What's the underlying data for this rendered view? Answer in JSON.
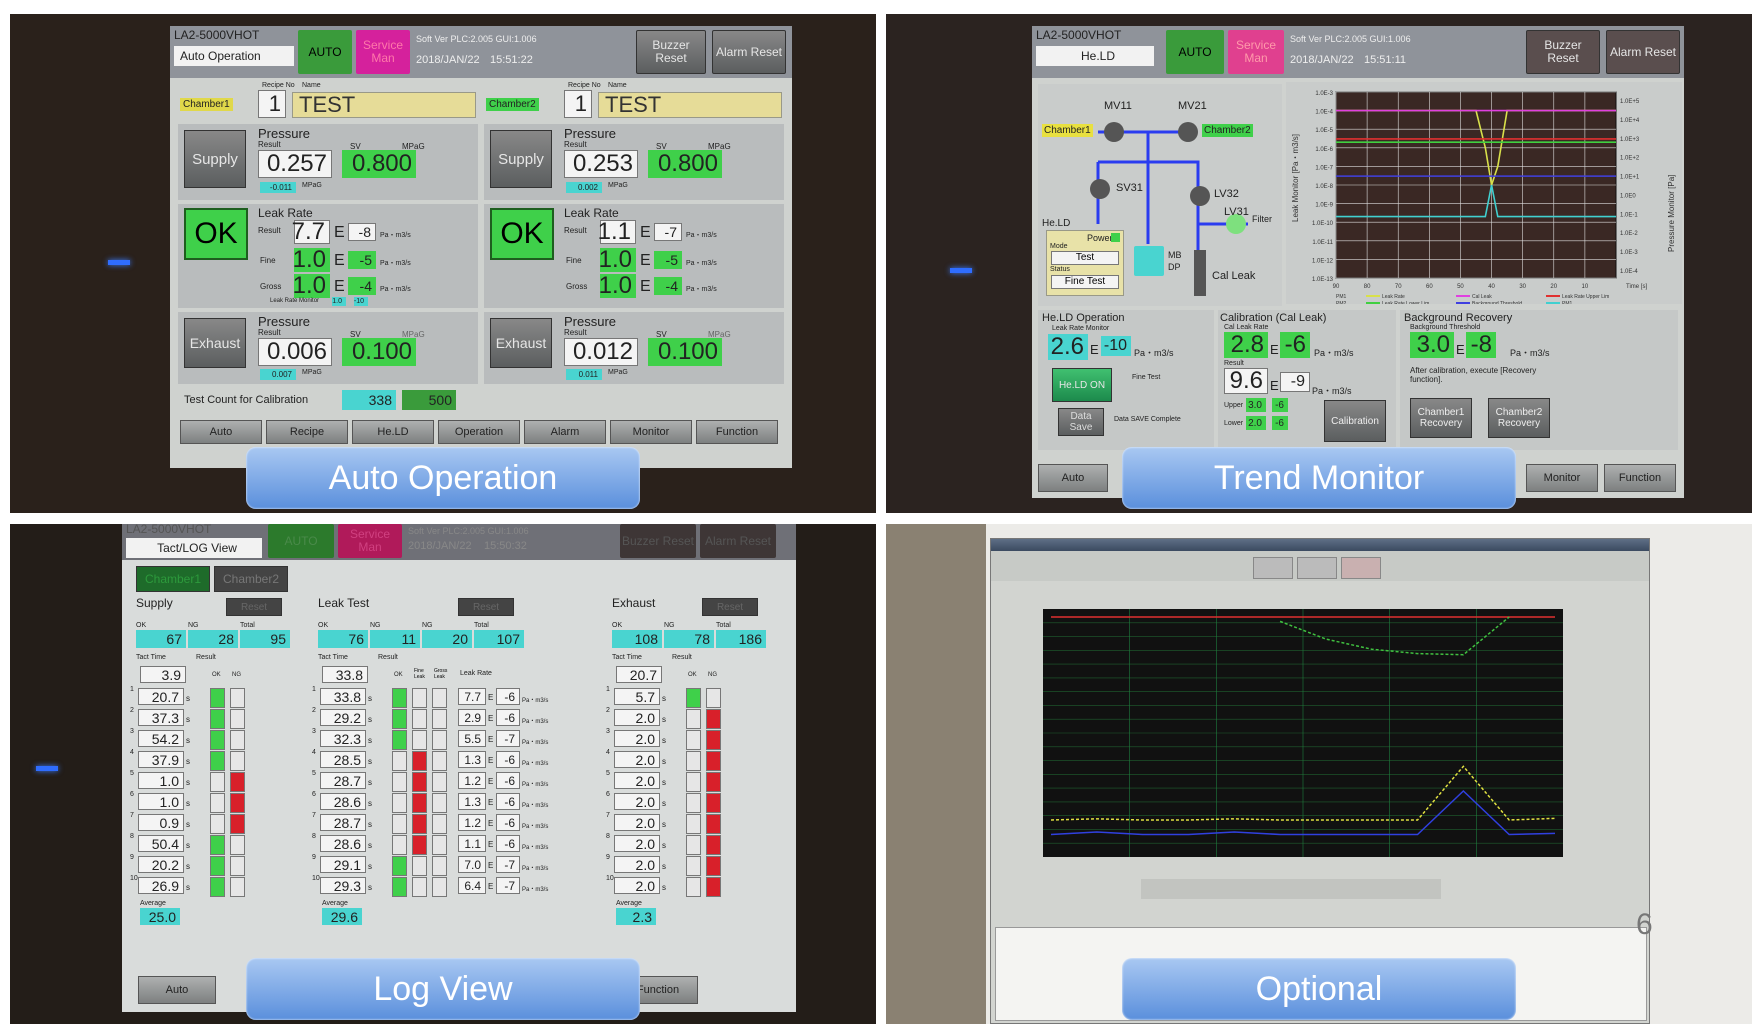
{
  "colors": {
    "ok_green": "#3fd04a",
    "auto_green": "#3a9b3b",
    "service_magenta": "#d5219c",
    "cyan": "#49d4d0",
    "ng_red": "#d8202a",
    "label_blue": "#6f9fe2"
  },
  "common": {
    "model": "LA2-5000VHOT",
    "auto": "AUTO",
    "service": "Service Man",
    "buzzer": "Buzzer Reset",
    "alarm": "Alarm Reset",
    "soft_ver": "Soft Ver PLC:2.005  GUI:1.006",
    "date": "2018/JAN/22"
  },
  "auto_op": {
    "caption": "Auto Operation",
    "screen_title": "Auto Operation",
    "time": "15:51:22",
    "recipe_no_label": "Recipe No",
    "name_label": "Name",
    "chambers": [
      {
        "label": "Chamber1",
        "recipe_no": "1",
        "name": "TEST",
        "supply_label": "Supply",
        "pressure_label": "Pressure",
        "result_label": "Result",
        "sv_label": "SV",
        "unit": "MPaG",
        "supply_result": "0.257",
        "supply_sv": "0.800",
        "supply_offset": "-0.011",
        "ok": "OK",
        "leak_label": "Leak Rate",
        "leak_result": "7.7",
        "leak_exp": "-8",
        "fine_label": "Fine",
        "fine_val": "1.0",
        "fine_exp": "-5",
        "gross_label": "Gross",
        "gross_val": "1.0",
        "gross_exp": "-4",
        "leak_unit": "Pa・m3/s",
        "monitor_label": "Leak Rate Monitor",
        "monitor_val": "1.0",
        "monitor_exp": "-10",
        "exhaust_label": "Exhaust",
        "exhaust_result": "0.006",
        "exhaust_sv": "0.100",
        "exhaust_offset": "0.007"
      },
      {
        "label": "Chamber2",
        "recipe_no": "1",
        "name": "TEST",
        "supply_label": "Supply",
        "pressure_label": "Pressure",
        "result_label": "Result",
        "sv_label": "SV",
        "unit": "MPaG",
        "supply_result": "0.253",
        "supply_sv": "0.800",
        "supply_offset": "0.002",
        "ok": "OK",
        "leak_label": "Leak Rate",
        "leak_result": "1.1",
        "leak_exp": "-7",
        "fine_label": "Fine",
        "fine_val": "1.0",
        "fine_exp": "-5",
        "gross_label": "Gross",
        "gross_val": "1.0",
        "gross_exp": "-4",
        "leak_unit": "Pa・m3/s",
        "exhaust_label": "Exhaust",
        "exhaust_result": "0.012",
        "exhaust_sv": "0.100",
        "exhaust_offset": "0.011"
      }
    ],
    "test_count_label": "Test Count for Calibration",
    "test_count": "338",
    "test_count_max": "500",
    "nav": [
      "Auto",
      "Recipe",
      "He.LD",
      "Operation",
      "Alarm",
      "Monitor",
      "Function"
    ]
  },
  "trend": {
    "caption": "Trend Monitor",
    "screen_title": "He.LD",
    "time": "15:51:11",
    "valves": [
      "MV11",
      "MV21",
      "SV31",
      "LV32",
      "LV31"
    ],
    "chamber1": "Chamber1",
    "chamber2": "Chamber2",
    "filter": "Filter",
    "held": "He.LD",
    "power": "Power",
    "mode_label": "Mode",
    "mode": "Test",
    "status_label": "Status",
    "status": "Fine Test",
    "mb": "MB",
    "dp": "DP",
    "cal_leak": "Cal Leak",
    "chart": {
      "type": "line",
      "ylabel_left": "Leak Monitor [Pa・m3/s]",
      "ylabel_right": "Pressure Monitor [Pa]",
      "xlabel": "Time [s]",
      "y_ticks_left": [
        "1.0E-3",
        "1.0E-4",
        "1.0E-5",
        "1.0E-6",
        "1.0E-7",
        "1.0E-8",
        "1.0E-9",
        "1.0E-10",
        "1.0E-11",
        "1.0E-12",
        "1.0E-13"
      ],
      "y_ticks_right": [
        "1.0E+5",
        "1.0E+4",
        "1.0E+3",
        "1.0E+2",
        "1.0E+1",
        "1.0E0",
        "1.0E-1",
        "1.0E-2",
        "1.0E-3",
        "1.0E-4"
      ],
      "x_ticks": [
        "90",
        "80",
        "70",
        "60",
        "50",
        "40",
        "30",
        "20",
        "10"
      ],
      "x": [
        90,
        80,
        70,
        60,
        50,
        45,
        42,
        40,
        38,
        35,
        30,
        20,
        10,
        0
      ],
      "series": [
        {
          "name": "Leak Rate",
          "color": "#d8e04a",
          "values": [
            0.0001,
            0.0001,
            0.0001,
            0.0001,
            0.0001,
            0.0001,
            1e-06,
            1e-08,
            1e-07,
            0.0001,
            0.0001,
            0.0001,
            0.0001,
            0.0001
          ]
        },
        {
          "name": "Cal Leak",
          "color": "#e040e0",
          "values": [
            0.0001,
            0.0001,
            0.0001,
            0.0001,
            0.0001,
            0.0001,
            0.0001,
            0.0001,
            0.0001,
            0.0001,
            0.0001,
            0.0001,
            0.0001,
            0.0001
          ]
        },
        {
          "name": "Leak Rate Upper Lim",
          "color": "#e03030",
          "values": [
            3e-06,
            3e-06,
            3e-06,
            3e-06,
            3e-06,
            3e-06,
            3e-06,
            3e-06,
            3e-06,
            3e-06,
            3e-06,
            3e-06,
            3e-06,
            3e-06
          ]
        },
        {
          "name": "Leak Rate Lower Lim",
          "color": "#40d040",
          "values": [
            2e-06,
            2e-06,
            2e-06,
            2e-06,
            2e-06,
            2e-06,
            2e-06,
            2e-06,
            2e-06,
            2e-06,
            2e-06,
            2e-06,
            2e-06,
            2e-06
          ]
        },
        {
          "name": "Background Threshold",
          "color": "#4040e0",
          "values": [
            3e-08,
            3e-08,
            3e-08,
            3e-08,
            3e-08,
            3e-08,
            3e-08,
            3e-08,
            3e-08,
            3e-08,
            3e-08,
            3e-08,
            3e-08,
            3e-08
          ]
        },
        {
          "name": "PM1",
          "color": "#40d0d0",
          "values": [
            2e-10,
            2e-10,
            2e-10,
            2e-10,
            2e-10,
            2e-10,
            2e-10,
            1e-08,
            2e-10,
            2e-10,
            2e-10,
            2e-10,
            2e-10,
            2e-10
          ]
        }
      ],
      "legend_prefix": [
        "PM1",
        "PM2"
      ]
    },
    "held_op": {
      "title": "He.LD Operation",
      "monitor_label": "Leak Rate Monitor",
      "val": "2.6",
      "exp": "-10",
      "unit": "Pa・m3/s",
      "on": "He.LD ON",
      "fine_test": "Fine Test",
      "data_save": "Data Save",
      "save_complete": "Data SAVE Complete"
    },
    "calib": {
      "title": "Calibration (Cal Leak)",
      "rate_label": "Cal Leak Rate",
      "val": "2.8",
      "exp": "-6",
      "result_label": "Result",
      "res_val": "9.6",
      "res_exp": "-9",
      "upper_label": "Upper",
      "upper_val": "3.0",
      "upper_exp": "-6",
      "lower_label": "Lower",
      "lower_val": "2.0",
      "lower_exp": "-6",
      "unit": "Pa・m3/s",
      "button": "Calibration"
    },
    "bg": {
      "title": "Background Recovery",
      "threshold_label": "Background Threshold",
      "val": "3.0",
      "exp": "-8",
      "unit": "Pa・m3/s",
      "note": "After calibration, execute [Recovery function].",
      "ch1": "Chamber1 Recovery",
      "ch2": "Chamber2 Recovery"
    },
    "nav": [
      "Auto",
      "Monitor",
      "Function"
    ]
  },
  "log": {
    "caption": "Log View",
    "screen_title": "Tact/LOG View",
    "time": "15:50:32",
    "chamber_tabs": [
      "Chamber1",
      "Chamber2"
    ],
    "reset": "Reset",
    "ok": "OK",
    "ng": "NG",
    "total": "Total",
    "tact": "Tact Time",
    "result": "Result",
    "average": "Average",
    "s": "s",
    "leak_rate": "Leak Rate",
    "fine_leak": "Fine Leak",
    "gross_leak": "Gross Leak",
    "unit": "Pa・m3/s",
    "supply": {
      "title": "Supply",
      "ok": "67",
      "ng": "28",
      "total": "95",
      "current": "3.9",
      "average": "25.0",
      "rows": [
        [
          "20.7",
          "OK"
        ],
        [
          "37.3",
          "OK"
        ],
        [
          "54.2",
          "OK"
        ],
        [
          "37.9",
          "OK"
        ],
        [
          "1.0",
          "NG"
        ],
        [
          "1.0",
          "NG"
        ],
        [
          "0.9",
          "NG"
        ],
        [
          "50.4",
          "OK"
        ],
        [
          "20.2",
          "OK"
        ],
        [
          "26.9",
          "OK"
        ]
      ]
    },
    "leak": {
      "title": "Leak Test",
      "ok": "76",
      "ng_fine": "11",
      "ng_gross": "20",
      "total": "107",
      "current": "33.8",
      "average": "29.6",
      "rows": [
        [
          "33.8",
          "OK",
          "7.7",
          "-6"
        ],
        [
          "29.2",
          "OK",
          "2.9",
          "-6"
        ],
        [
          "32.3",
          "OK",
          "5.5",
          "-7"
        ],
        [
          "28.5",
          "FINE",
          "1.3",
          "-6"
        ],
        [
          "28.7",
          "FINE",
          "1.2",
          "-6"
        ],
        [
          "28.6",
          "FINE",
          "1.3",
          "-6"
        ],
        [
          "28.7",
          "FINE",
          "1.2",
          "-6"
        ],
        [
          "28.6",
          "FINE",
          "1.1",
          "-6"
        ],
        [
          "29.1",
          "OK",
          "7.0",
          "-7"
        ],
        [
          "29.3",
          "OK",
          "6.4",
          "-7"
        ]
      ]
    },
    "exhaust": {
      "title": "Exhaust",
      "ok": "108",
      "ng": "78",
      "total": "186",
      "current": "20.7",
      "average": "2.3",
      "rows": [
        [
          "5.7",
          "OK"
        ],
        [
          "2.0",
          "NG"
        ],
        [
          "2.0",
          "NG"
        ],
        [
          "2.0",
          "NG"
        ],
        [
          "2.0",
          "NG"
        ],
        [
          "2.0",
          "NG"
        ],
        [
          "2.0",
          "NG"
        ],
        [
          "2.0",
          "NG"
        ],
        [
          "2.0",
          "NG"
        ],
        [
          "2.0",
          "NG"
        ]
      ]
    },
    "nav": [
      "Auto",
      "Function"
    ]
  },
  "optional": {
    "caption": "Optional",
    "page_number": "6",
    "chart": {
      "type": "line",
      "series": [
        {
          "color": "#e03030",
          "values": [
            10000,
            10000,
            10000,
            10000,
            10000,
            10000,
            10000,
            10000,
            10000,
            10000,
            10000,
            10000
          ]
        },
        {
          "color": "#40c040",
          "values": [
            null,
            null,
            null,
            null,
            null,
            5000,
            300,
            60,
            30,
            25,
            10000,
            null
          ]
        },
        {
          "color": "#e0e040",
          "values": [
            1e-10,
            1.2e-10,
            1e-10,
            1e-10,
            1.2e-10,
            1e-10,
            1e-10,
            1e-10,
            1e-10,
            5e-07,
            1e-10,
            1.3e-10
          ]
        },
        {
          "color": "#3040e0",
          "values": [
            1e-11,
            1.5e-11,
            1e-11,
            1e-11,
            1.5e-11,
            1e-11,
            1e-11,
            1e-11,
            1e-11,
            1e-08,
            1e-11,
            1.2e-11
          ]
        }
      ]
    }
  }
}
